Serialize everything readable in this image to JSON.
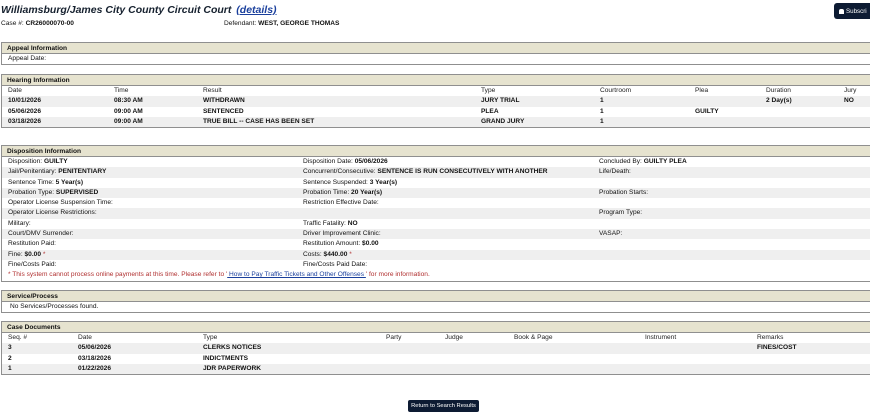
{
  "header": {
    "court": "Williamsburg/James City County Circuit Court",
    "details_link": "(details)",
    "case_label": "Case #:",
    "case_number": "CR26000070-00",
    "defendant_label": "Defendant:",
    "defendant": "WEST, GEORGE THOMAS",
    "subscribe_label": "Subscri"
  },
  "appeal": {
    "title": "Appeal Information",
    "date_label": "Appeal Date:",
    "date_value": ""
  },
  "hearing": {
    "title": "Hearing Information",
    "columns": [
      "Date",
      "Time",
      "Result",
      "Type",
      "Courtroom",
      "Plea",
      "Duration",
      "Jury"
    ],
    "rows": [
      [
        "10/01/2026",
        "08:30 AM",
        "WITHDRAWN",
        "JURY TRIAL",
        "1",
        "",
        "2 Day(s)",
        "NO"
      ],
      [
        "05/06/2026",
        "09:00 AM",
        "SENTENCED",
        "PLEA",
        "1",
        "GUILTY",
        "",
        ""
      ],
      [
        "03/18/2026",
        "09:00 AM",
        "TRUE BILL -- CASE HAS BEEN SET",
        "GRAND JURY",
        "1",
        "",
        "",
        ""
      ]
    ]
  },
  "disposition": {
    "title": "Disposition Information",
    "rows": [
      [
        {
          "l": "Disposition:",
          "v": "GUILTY"
        },
        {
          "l": "Disposition Date:",
          "v": "05/06/2026"
        },
        {
          "l": "Concluded By:",
          "v": "GUILTY PLEA"
        }
      ],
      [
        {
          "l": "Jail/Penitentiary:",
          "v": "PENITENTIARY"
        },
        {
          "l": "Concurrent/Consecutive:",
          "v": "SENTENCE IS RUN CONSECUTIVELY WITH ANOTHER"
        },
        {
          "l": "Life/Death:",
          "v": ""
        }
      ],
      [
        {
          "l": "Sentence Time:",
          "v": "5 Year(s)"
        },
        {
          "l": "Sentence Suspended:",
          "v": "3 Year(s)"
        },
        {
          "l": "",
          "v": ""
        }
      ],
      [
        {
          "l": "Probation Type:",
          "v": "SUPERVISED"
        },
        {
          "l": "Probation Time:",
          "v": "20 Year(s)"
        },
        {
          "l": "Probation Starts:",
          "v": ""
        }
      ],
      [
        {
          "l": "Operator License Suspension Time:",
          "v": ""
        },
        {
          "l": "Restriction Effective Date:",
          "v": ""
        },
        {
          "l": "",
          "v": ""
        }
      ],
      [
        {
          "l": "Operator License Restrictions:",
          "v": ""
        },
        {
          "l": "",
          "v": ""
        },
        {
          "l": "Program Type:",
          "v": ""
        }
      ],
      [
        {
          "l": "Military:",
          "v": ""
        },
        {
          "l": "Traffic Fatality:",
          "v": "NO"
        },
        {
          "l": "",
          "v": ""
        }
      ],
      [
        {
          "l": "Court/DMV Surrender:",
          "v": ""
        },
        {
          "l": "Driver Improvement Clinic:",
          "v": ""
        },
        {
          "l": "VASAP:",
          "v": ""
        }
      ],
      [
        {
          "l": "Restitution Paid:",
          "v": ""
        },
        {
          "l": "Restitution Amount:",
          "v": "$0.00"
        },
        {
          "l": "",
          "v": ""
        }
      ],
      [
        {
          "l": "Fine:",
          "v": "$0.00",
          "s": " *"
        },
        {
          "l": "Costs:",
          "v": "$440.00",
          "s": " *"
        },
        {
          "l": "",
          "v": ""
        }
      ],
      [
        {
          "l": "Fine/Costs Paid:",
          "v": ""
        },
        {
          "l": "Fine/Costs Paid Date:",
          "v": ""
        },
        {
          "l": "",
          "v": ""
        }
      ]
    ],
    "note_prefix": "* This system cannot process online payments at this time. Please refer to '",
    "note_link": " How to Pay Traffic Tickets and Other Offenses ",
    "note_suffix": "' for more information."
  },
  "service": {
    "title": "Service/Process",
    "empty": "No Services/Processes found."
  },
  "documents": {
    "title": "Case Documents",
    "columns": [
      "Seq. #",
      "Date",
      "Type",
      "Party",
      "Judge",
      "Book & Page",
      "Instrument",
      "Remarks"
    ],
    "rows": [
      [
        "3",
        "05/06/2026",
        "CLERKS NOTICES",
        "",
        "",
        "",
        "",
        "FINES/COST"
      ],
      [
        "2",
        "03/18/2026",
        "INDICTMENTS",
        "",
        "",
        "",
        "",
        ""
      ],
      [
        "1",
        "01/22/2026",
        "JDR PAPERWORK",
        "",
        "",
        "",
        "",
        ""
      ]
    ]
  },
  "return_button": "Return to Search Results"
}
